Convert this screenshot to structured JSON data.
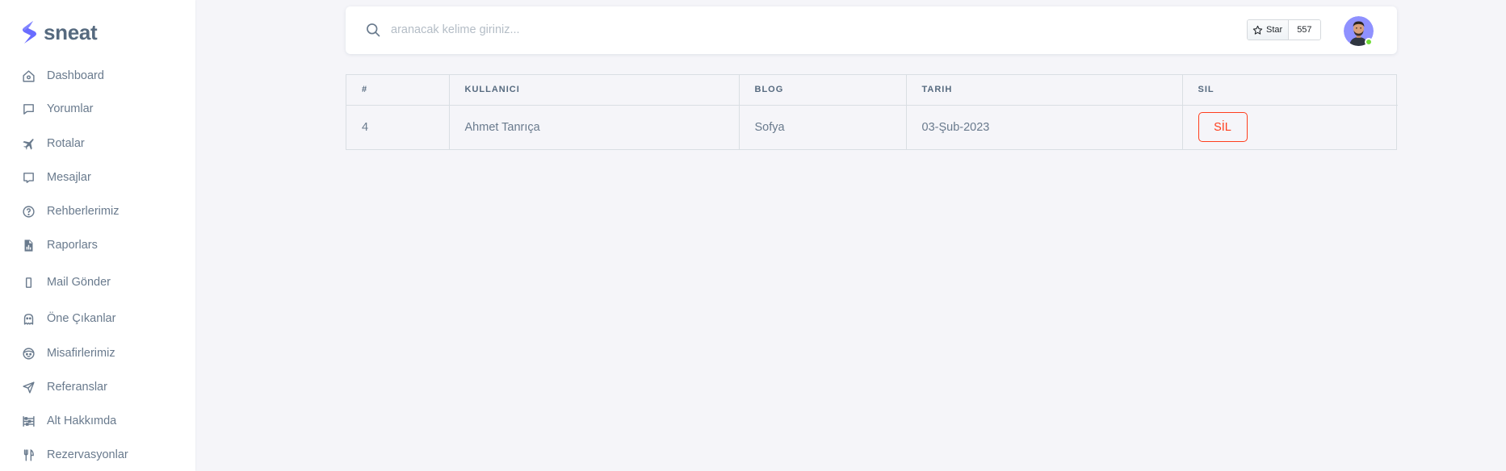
{
  "brand": {
    "name": "sneat",
    "accent": "#696cff"
  },
  "sidebar": {
    "items": [
      {
        "label": "Dashboard",
        "icon": "home-icon"
      },
      {
        "label": "Yorumlar",
        "icon": "message-square-icon"
      },
      {
        "label": "Rotalar",
        "icon": "plane-icon"
      },
      {
        "label": "Mesajlar",
        "icon": "message-icon"
      },
      {
        "label": "Rehberlerimiz",
        "icon": "help-circle-icon"
      },
      {
        "label": "Raporlars",
        "icon": "report-file-icon"
      },
      {
        "label": "Mail Gönder",
        "icon": "mobile-icon"
      },
      {
        "label": "Öne Çıkanlar",
        "icon": "ghost-icon"
      },
      {
        "label": "Misafirlerimiz",
        "icon": "face-icon"
      },
      {
        "label": "Referanslar",
        "icon": "send-icon"
      },
      {
        "label": "Alt Hakkımda",
        "icon": "abacus-icon"
      },
      {
        "label": "Rezervasyonlar",
        "icon": "restaurant-icon"
      }
    ]
  },
  "navbar": {
    "search_placeholder": "aranacak kelime giriniz...",
    "star_label": "Star",
    "star_count": "557",
    "online_status_color": "#71dd37"
  },
  "table": {
    "headers": [
      "#",
      "KULLANICI",
      "BLOG",
      "TARIH",
      "SIL"
    ],
    "rows": [
      {
        "id": "4",
        "user": "Ahmet Tanrıça",
        "blog": "Sofya",
        "date": "03-Şub-2023",
        "action": "SİL"
      }
    ],
    "danger_color": "#ff3e1d"
  }
}
